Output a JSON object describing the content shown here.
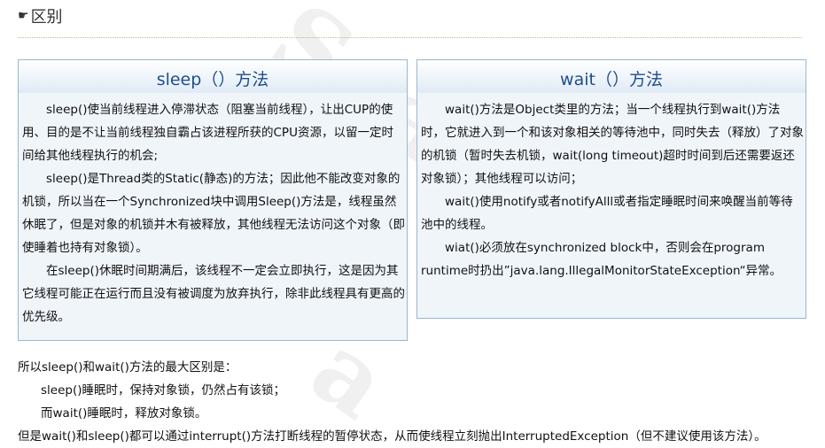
{
  "heading": {
    "icon": "pointing-hand-icon",
    "title": "区别"
  },
  "left_panel": {
    "title": "sleep（）方法",
    "paragraphs": [
      "sleep()使当前线程进入停滞状态（阻塞当前线程），让出CUP的使用、目的是不让当前线程独自霸占该进程所获的CPU资源，以留一定时间给其他线程执行的机会;",
      "sleep()是Thread类的Static(静态)的方法；因此他不能改变对象的机锁，所以当在一个Synchronized块中调用Sleep()方法是，线程虽然休眠了，但是对象的机锁并木有被释放，其他线程无法访问这个对象（即使睡着也持有对象锁）。",
      "在sleep()休眠时间期满后，该线程不一定会立即执行，这是因为其它线程可能正在运行而且没有被调度为放弃执行，除非此线程具有更高的优先级。"
    ]
  },
  "right_panel": {
    "title": "wait（）方法",
    "paragraphs": [
      "wait()方法是Object类里的方法；当一个线程执行到wait()方法时，它就进入到一个和该对象相关的等待池中，同时失去（释放）了对象的机锁（暂时失去机锁，wait(long timeout)超时时间到后还需要返还对象锁）；其他线程可以访问；",
      "wait()使用notify或者notifyAlll或者指定睡眠时间来唤醒当前等待池中的线程。",
      "wiat()必须放在synchronized block中，否则会在program runtime时扔出”java.lang.IllegalMonitorStateException“异常。"
    ]
  },
  "summary": {
    "intro": "所以sleep()和wait()方法的最大区别是：",
    "line1": "sleep()睡眠时，保持对象锁，仍然占有该锁；",
    "line2": "而wait()睡眠时，释放对象锁。",
    "line3": "但是wait()和sleep()都可以通过interrupt()方法打断线程的暂停状态，从而使线程立刻抛出InterruptedException（但不建议使用该方法）。"
  }
}
